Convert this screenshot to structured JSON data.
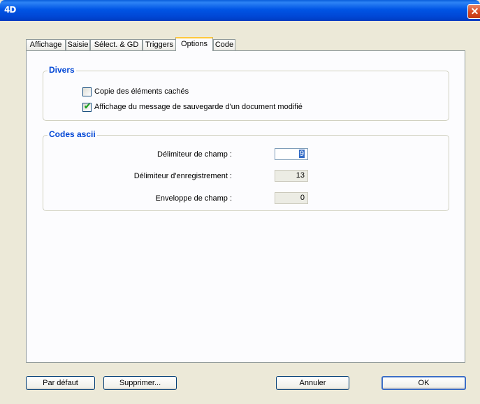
{
  "window": {
    "title_logo": "4D",
    "close_glyph": "✕"
  },
  "tabs": [
    {
      "label": "Affichage",
      "active": false
    },
    {
      "label": "Saisie",
      "active": false
    },
    {
      "label": "Sélect. & GD",
      "active": false
    },
    {
      "label": "Triggers",
      "active": false
    },
    {
      "label": "Options",
      "active": true
    },
    {
      "label": "Code",
      "active": false
    }
  ],
  "divers": {
    "title": "Divers",
    "options": [
      {
        "label": "Copie des éléments cachés",
        "checked": false
      },
      {
        "label": "Affichage du message de sauvegarde d'un document modifié",
        "checked": true
      }
    ]
  },
  "ascii": {
    "title": "Codes ascii",
    "fields": [
      {
        "label": "Délimiteur de champ :",
        "value": "9",
        "focused": true
      },
      {
        "label": "Délimiteur d'enregistrement :",
        "value": "13",
        "focused": false
      },
      {
        "label": "Enveloppe de champ :",
        "value": "0",
        "focused": false
      }
    ]
  },
  "buttons": {
    "default_label": "Par défaut",
    "delete_label": "Supprimer...",
    "cancel_label": "Annuler",
    "ok_label": "OK"
  },
  "colors": {
    "titlebar": "#0055e5",
    "group_title": "#0046d5",
    "tab_active_accent": "#ffc83c",
    "check_mark": "#21a121"
  }
}
